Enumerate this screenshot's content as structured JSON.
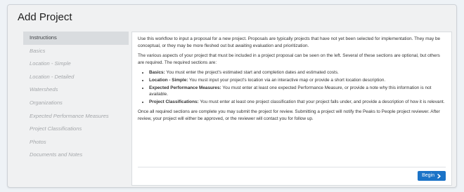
{
  "page": {
    "title": "Add Project"
  },
  "sidebar": {
    "items": [
      {
        "label": "Instructions",
        "active": true
      },
      {
        "label": "Basics"
      },
      {
        "label": "Location - Simple"
      },
      {
        "label": "Location - Detailed"
      },
      {
        "label": "Watersheds"
      },
      {
        "label": "Organizations"
      },
      {
        "label": "Expected Performance Measures"
      },
      {
        "label": "Project Classifications"
      },
      {
        "label": "Photos"
      },
      {
        "label": "Documents and Notes"
      }
    ]
  },
  "instructions": {
    "intro": "Use this workflow to input a proposal for a new project. Proposals are typically projects that have not yet been selected for implementation. They may be conceptual, or they may be more fleshed out but awaiting evaluation and prioritization.",
    "sections_intro": "The various aspects of your project that must be included in a project proposal can be seen on the left. Several of these sections are optional, but others are required. The required sections are:",
    "requirements": [
      {
        "term": "Basics:",
        "text": " You must enter the project's estimated start and completion dates and estimated costs."
      },
      {
        "term": "Location - Simple:",
        "text": " You must input your project's location via an interactive map or provide a short location description."
      },
      {
        "term": "Expected Performance Measures:",
        "text": " You must enter at least one expected Performance Measure, or provide a note why this information is not available."
      },
      {
        "term": "Project Classifications:",
        "text": " You must enter at least one project classification that your project falls under, and provide a description of how it is relevant."
      }
    ],
    "closing": "Once all required sections are complete you may submit the project for review. Submitting a project will notify the Peaks to People project reviewer. After review, your project will either be approved, or the reviewer will contact you for follow up."
  },
  "actions": {
    "begin_label": "Begin",
    "begin_icon": "chevron-right-icon"
  },
  "colors": {
    "accent": "#1b73c7",
    "active_nav_bg": "#d9dcdf",
    "inactive_nav_text": "#a4a7aa"
  }
}
